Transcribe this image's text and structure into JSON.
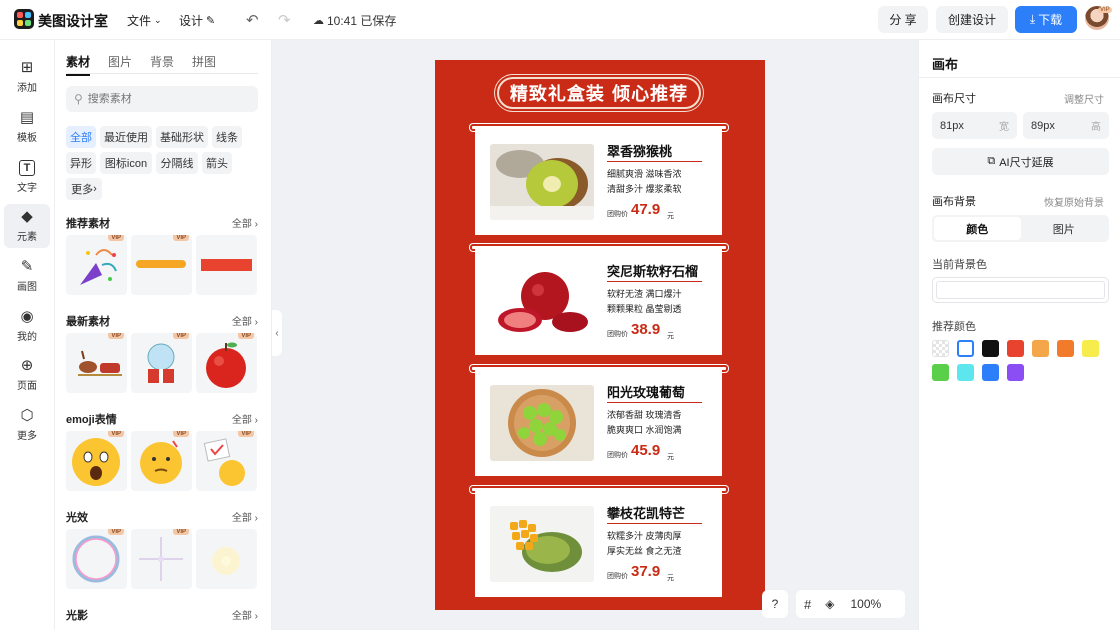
{
  "app": {
    "name": "美图设计室"
  },
  "topbar": {
    "menu_file": "文件",
    "menu_design": "设计",
    "save_status": "10:41 已保存",
    "share_label": "分 享",
    "create_label": "创建设计",
    "download_label": "下载",
    "avatar_badge": "VIP"
  },
  "rail": {
    "items": [
      {
        "label": "添加",
        "icon": "plus-square-icon"
      },
      {
        "label": "模板",
        "icon": "template-icon"
      },
      {
        "label": "文字",
        "icon": "text-icon"
      },
      {
        "label": "元素",
        "icon": "shapes-icon"
      },
      {
        "label": "画图",
        "icon": "draw-icon"
      },
      {
        "label": "我的",
        "icon": "user-icon"
      },
      {
        "label": "页面",
        "icon": "page-add-icon"
      },
      {
        "label": "更多",
        "icon": "cube-icon"
      }
    ]
  },
  "panel": {
    "tabs": [
      "素材",
      "图片",
      "背景",
      "拼图"
    ],
    "search_placeholder": "搜索素材",
    "chips": [
      "全部",
      "最近使用",
      "基础形状",
      "线条",
      "异形",
      "图标icon",
      "分隔线",
      "箭头",
      "更多"
    ],
    "sections": [
      {
        "title": "推荐素材",
        "more": "全部"
      },
      {
        "title": "最新素材",
        "more": "全部"
      },
      {
        "title": "emoji表情",
        "more": "全部"
      },
      {
        "title": "光效",
        "more": "全部"
      },
      {
        "title": "光影",
        "more": "全部"
      }
    ],
    "vip_badge": "VIP"
  },
  "canvas": {
    "banner_title": "精致礼盒装 倾心推荐",
    "price_label": "团购价",
    "unit": "元",
    "bg_color": "#c92b16",
    "products": [
      {
        "name": "翠香猕猴桃",
        "desc1": "细腻爽滑 滋味香浓",
        "desc2": "清甜多汁 爆浆柔软",
        "price": "47.9"
      },
      {
        "name": "突尼斯软籽石榴",
        "desc1": "软籽无渣 满口爆汁",
        "desc2": "颗颗果粒 晶莹剔透",
        "price": "38.9"
      },
      {
        "name": "阳光玫瑰葡萄",
        "desc1": "浓郁香甜 玫瑰清香",
        "desc2": "脆爽爽口 水润饱满",
        "price": "45.9"
      },
      {
        "name": "攀枝花凯特芒",
        "desc1": "软糯多汁 皮薄肉厚",
        "desc2": "厚实无丝 食之无渣",
        "price": "37.9"
      }
    ]
  },
  "view": {
    "help": "?",
    "zoom": "100%"
  },
  "right": {
    "title": "画布",
    "size_label": "画布尺寸",
    "size_link": "调整尺寸",
    "width_value": "81px",
    "width_unit": "宽",
    "height_value": "89px",
    "height_unit": "高",
    "ai_button": "AI尺寸延展",
    "bg_label": "画布背景",
    "bg_link": "恢复原始背景",
    "seg_color": "颜色",
    "seg_image": "图片",
    "current_bg_label": "当前背景色",
    "recommend_label": "推荐颜色",
    "swatches": [
      "transparent",
      "#ffffff",
      "#111111",
      "#e8432f",
      "#f5a54a",
      "#f27a2b",
      "#f6ec4b",
      "#5ad04a",
      "#5ee6ee",
      "#2d7ff9",
      "#8b4ef5"
    ]
  }
}
